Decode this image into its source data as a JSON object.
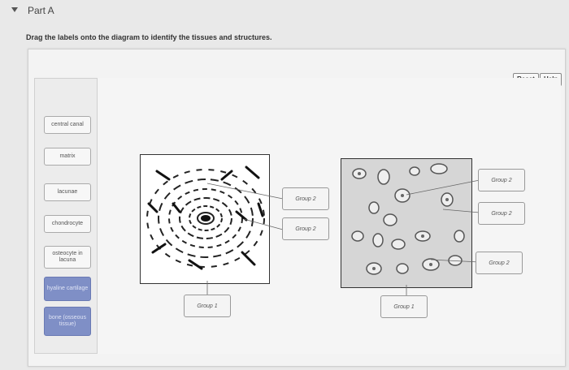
{
  "header": {
    "title": "Part A"
  },
  "instructions": "Drag the labels onto the diagram to identify the tissues and structures.",
  "toolbar": {
    "reset_label": "Reset",
    "help_label": "Help"
  },
  "labels": [
    {
      "text": "central canal"
    },
    {
      "text": "matrix"
    },
    {
      "text": "lacunae"
    },
    {
      "text": "chondrocyte"
    },
    {
      "text": "osteocyte in lacuna"
    },
    {
      "text": "hyaline cartilage"
    },
    {
      "text": "bone (osseous tissue)"
    }
  ],
  "drop_targets": {
    "bone_group1": "Group 1",
    "bone_group2_a": "Group 2",
    "bone_group2_b": "Group 2",
    "cart_group1": "Group 1",
    "cart_group2_a": "Group 2",
    "cart_group2_b": "Group 2",
    "cart_group2_c": "Group 2"
  }
}
